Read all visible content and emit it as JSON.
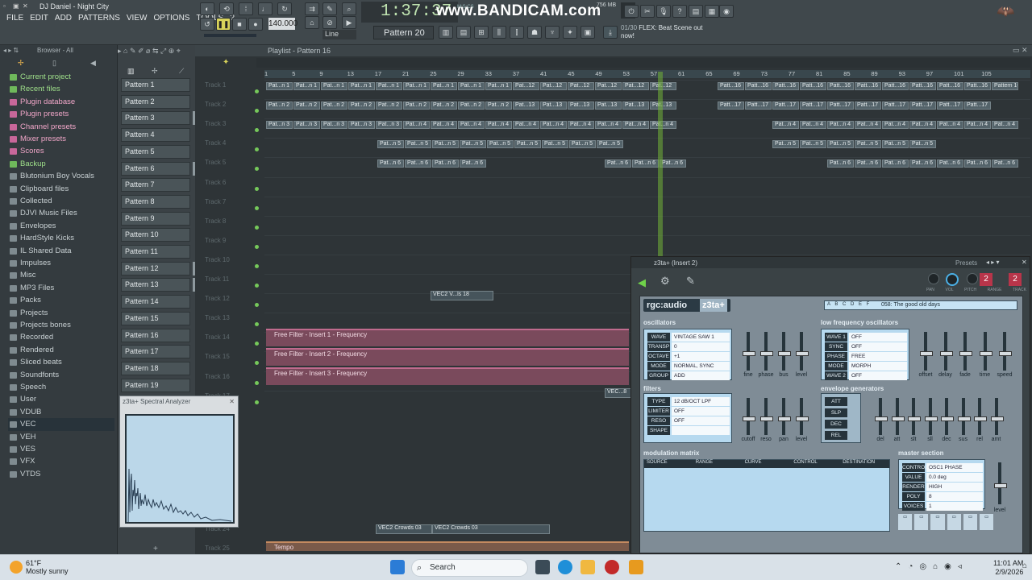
{
  "window": {
    "title": "DJ Daniel - Night City"
  },
  "menu": [
    "FILE",
    "EDIT",
    "ADD",
    "PATTERNS",
    "VIEW",
    "OPTIONS",
    "TOOLS",
    "?"
  ],
  "transport": {
    "time": "1:37:37",
    "time_unit": "M:S:CS",
    "tempo": "140.000",
    "line_mode": "Line",
    "pattern": "Pattern 20",
    "memory": "756 MB",
    "voices": "7"
  },
  "watermark": "www.BANDICAM.com",
  "hint": {
    "counter": "01/30",
    "text": "FLEX: Beat Scene out now!"
  },
  "browser": {
    "header": "Browser - All",
    "items": [
      {
        "label": "Current project",
        "style": "green"
      },
      {
        "label": "Recent files",
        "style": "green"
      },
      {
        "label": "Plugin database",
        "style": "pink"
      },
      {
        "label": "Plugin presets",
        "style": "pink"
      },
      {
        "label": "Channel presets",
        "style": "pink"
      },
      {
        "label": "Mixer presets",
        "style": "pink"
      },
      {
        "label": "Scores",
        "style": "pink"
      },
      {
        "label": "Backup",
        "style": "green"
      },
      {
        "label": "Blutonium Boy Vocals",
        "style": ""
      },
      {
        "label": "Clipboard files",
        "style": ""
      },
      {
        "label": "Collected",
        "style": ""
      },
      {
        "label": "DJVI Music Files",
        "style": ""
      },
      {
        "label": "Envelopes",
        "style": ""
      },
      {
        "label": "HardStyle Kicks",
        "style": ""
      },
      {
        "label": "IL Shared Data",
        "style": ""
      },
      {
        "label": "Impulses",
        "style": ""
      },
      {
        "label": "Misc",
        "style": ""
      },
      {
        "label": "MP3 Files",
        "style": ""
      },
      {
        "label": "Packs",
        "style": ""
      },
      {
        "label": "Projects",
        "style": ""
      },
      {
        "label": "Projects bones",
        "style": ""
      },
      {
        "label": "Recorded",
        "style": ""
      },
      {
        "label": "Rendered",
        "style": ""
      },
      {
        "label": "Sliced beats",
        "style": ""
      },
      {
        "label": "Soundfonts",
        "style": ""
      },
      {
        "label": "Speech",
        "style": ""
      },
      {
        "label": "User",
        "style": ""
      },
      {
        "label": "VDUB",
        "style": ""
      },
      {
        "label": "VEC",
        "style": "sel"
      },
      {
        "label": "VEH",
        "style": ""
      },
      {
        "label": "VES",
        "style": ""
      },
      {
        "label": "VFX",
        "style": ""
      },
      {
        "label": "VTDS",
        "style": ""
      }
    ]
  },
  "patterns": [
    "Pattern 1",
    "Pattern 2",
    "Pattern 3",
    "Pattern 4",
    "Pattern 5",
    "Pattern 6",
    "Pattern 7",
    "Pattern 8",
    "Pattern 9",
    "Pattern 10",
    "Pattern 11",
    "Pattern 12",
    "Pattern 13",
    "Pattern 14",
    "Pattern 15",
    "Pattern 16",
    "Pattern 17",
    "Pattern 18",
    "Pattern 19"
  ],
  "playlist": {
    "title": "Playlist - Pattern 16",
    "ruler": [
      "1",
      "5",
      "9",
      "13",
      "17",
      "21",
      "25",
      "29",
      "33",
      "37",
      "41",
      "45",
      "49",
      "53",
      "57",
      "61",
      "65",
      "69",
      "73",
      "77",
      "81",
      "85",
      "89",
      "93",
      "97",
      "101",
      "105"
    ],
    "tracks": [
      "Track 1",
      "Track 2",
      "Track 3",
      "Track 4",
      "Track 5",
      "Track 6",
      "Track 7",
      "Track 8",
      "Track 9",
      "Track 10",
      "Track 11",
      "Track 12",
      "Track 13",
      "Track 14",
      "Track 15",
      "Track 16",
      "Track 17"
    ],
    "bottom_tracks": [
      "Track 24",
      "Track 25"
    ],
    "automation": [
      "Free Filter - Insert 1 - Frequency",
      "Free Filter - Insert 2 - Frequency",
      "Free Filter - Insert 3 - Frequency"
    ],
    "audio_clips": [
      "VEC2 V...ls 18",
      "VEC2 Crowds 03",
      "VEC2 Crowds 03",
      "VEC...8"
    ],
    "tempo_clip": "Tempo",
    "clip_labels": {
      "t1": "Pat...n 1",
      "t1b": "Pat...12",
      "t1c": "Patt...16",
      "t1d": "Pattern 16",
      "t2": "Pat...n 2",
      "t2b": "Pat...13",
      "t2c": "Patt...17",
      "t3": "Pat...n 3",
      "t3b": "Pat...n 4",
      "t4": "Pat...n 5",
      "t5": "Pat...n 6"
    }
  },
  "plugin": {
    "title": "z3ta+ (Insert 2)",
    "presets_label": "Presets",
    "knobs": [
      "PAN",
      "VOL",
      "PITCH",
      "RANGE",
      "TRACK"
    ],
    "range_value": "2",
    "track_value": "2",
    "brand": "rgc:audio",
    "product": "z3ta+",
    "preset_name": "058:  The good old days",
    "oscillators": {
      "title": "oscillators",
      "rows": [
        [
          "WAVE",
          "VINTAGE SAW 1"
        ],
        [
          "TRANSP",
          "0"
        ],
        [
          "OCTAVE",
          "+1"
        ],
        [
          "MODE",
          "NORMAL, SYNC"
        ],
        [
          "GROUP",
          "ADD"
        ]
      ],
      "faders": [
        "fine",
        "phase",
        "bus",
        "level"
      ]
    },
    "lfo": {
      "title": "low frequency oscillators",
      "rows": [
        [
          "WAVE 1",
          "OFF"
        ],
        [
          "SYNC",
          "OFF"
        ],
        [
          "PHASE",
          "FREE"
        ],
        [
          "MODE",
          "MORPH"
        ],
        [
          "WAVE 2",
          "OFF"
        ]
      ],
      "faders": [
        "offset",
        "delay",
        "fade",
        "time",
        "speed"
      ],
      "local": "local"
    },
    "filters": {
      "title": "filters",
      "rows": [
        [
          "TYPE",
          "12 dB/OCT LPF"
        ],
        [
          "LIMITER",
          "OFF"
        ],
        [
          "RESO RST",
          "OFF"
        ],
        [
          "SHAPE",
          ""
        ]
      ],
      "faders": [
        "cutoff",
        "reso",
        "pan",
        "level"
      ]
    },
    "envelopes": {
      "title": "envelope generators",
      "rows": [
        "ATT",
        "SLP",
        "DEC",
        "REL"
      ],
      "faders": [
        "del",
        "att",
        "slt",
        "sll",
        "dec",
        "sus",
        "rel",
        "amt"
      ]
    },
    "modmatrix": {
      "title": "modulation matrix",
      "columns": [
        "SOURCE",
        "RANGE",
        "CURVE",
        "CONTROL",
        "DESTINATION"
      ]
    },
    "master": {
      "title": "master section",
      "rows": [
        [
          "CONTROL",
          "OSC1 PHASE"
        ],
        [
          "VALUE",
          "0.0 deg"
        ],
        [
          "RENDER",
          "HIGH"
        ],
        [
          "POLY",
          "8"
        ],
        [
          "VOICES",
          "1"
        ]
      ],
      "fader": "level"
    }
  },
  "spectral": {
    "title": "z3ta+ Spectral Analyzer"
  },
  "taskbar": {
    "temp": "61°F",
    "weather": "Mostly sunny",
    "search": "Search",
    "time": "11:01 AM",
    "date": "2/9/2026"
  },
  "colors": {
    "accent_green": "#76c95a",
    "automation": "#c06b8e",
    "browser_pink": "#f0a6c8"
  }
}
